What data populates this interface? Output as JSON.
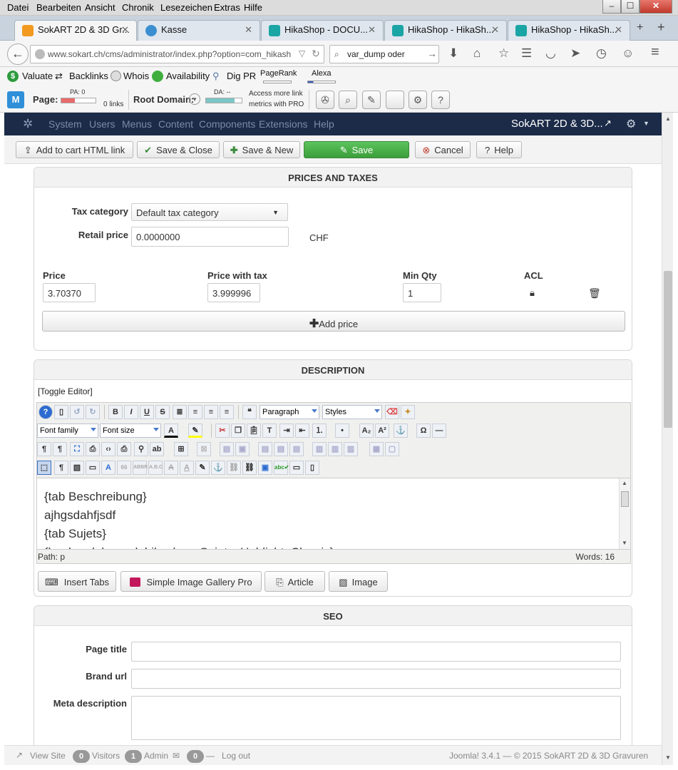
{
  "menubar": {
    "items": [
      "Datei",
      "Bearbeiten",
      "Ansicht",
      "Chronik",
      "Lesezeichen",
      "Extras",
      "Hilfe"
    ]
  },
  "tabs": [
    {
      "label": "SokART 2D & 3D Gr...",
      "color": "#f29a1f"
    },
    {
      "label": "Kasse",
      "color": "#3b8fd1"
    },
    {
      "label": "HikaShop - DOCU...",
      "color": "#1aa5a5"
    },
    {
      "label": "HikaShop - HikaSh...",
      "color": "#1aa5a5"
    },
    {
      "label": "HikaShop - HikaSh...",
      "color": "#1aa5a5"
    }
  ],
  "navbar": {
    "url": "www.sokart.ch/cms/administrator/index.php?option=com_hikash",
    "search": "var_dump oder"
  },
  "bookmarks": {
    "valuate": "Valuate",
    "backlinks": "Backlinks",
    "whois": "Whois",
    "availability": "Availability",
    "digpr": "Dig PR",
    "pagerank": "PageRank",
    "alexa": "Alexa"
  },
  "moz": {
    "page_label": "Page:",
    "pa": "PA: 0",
    "links": "0 links",
    "root_label": "Root Domain:",
    "da": "DA: --",
    "access": "Access more link",
    "metrics": "metrics with PRO"
  },
  "jnav": {
    "items": [
      "System",
      "Users",
      "Menus",
      "Content",
      "Components",
      "Extensions",
      "Help"
    ],
    "site": "SokART 2D & 3D..."
  },
  "toolbar": {
    "add_cart": "Add to cart HTML link",
    "save_close": "Save & Close",
    "save_new": "Save & New",
    "save": "Save",
    "cancel": "Cancel",
    "help": "Help"
  },
  "prices": {
    "header": "PRICES AND TAXES",
    "tax_label": "Tax category",
    "tax_value": "Default tax category",
    "retail_label": "Retail price",
    "retail_value": "0.0000000",
    "currency": "CHF",
    "price_label": "Price",
    "price_value": "3.70370",
    "pwt_label": "Price with tax",
    "pwt_value": "3.999996",
    "minqty_label": "Min Qty",
    "minqty_value": "1",
    "acl_label": "ACL",
    "add_price": "Add price"
  },
  "description": {
    "header": "DESCRIPTION",
    "toggle": "[Toggle Editor]",
    "paragraph": "Paragraph",
    "styles": "Styles",
    "font_family": "Font family",
    "font_size": "Font size",
    "lines": [
      "{tab Beschreibung}",
      "ajhgsdahfjsdf",
      "{tab Sujets}",
      "{loadmodule mod_hikashop_Sujets_Hablicht_Classic}"
    ],
    "path": "Path:  p",
    "words": "Words: 16",
    "btn_tabs": "Insert Tabs",
    "btn_gallery": "Simple Image Gallery Pro",
    "btn_article": "Article",
    "btn_image": "Image"
  },
  "seo": {
    "header": "SEO",
    "page_title": "Page title",
    "brand_url": "Brand url",
    "meta_desc": "Meta description"
  },
  "status": {
    "view_site": "View Site",
    "visitors_count": "0",
    "visitors": "Visitors",
    "admin_count": "1",
    "admin": "Admin",
    "msg_count": "0",
    "logout": "Log out",
    "version": "Joomla! 3.4.1  —  © 2015 SokART 2D & 3D Gravuren"
  }
}
